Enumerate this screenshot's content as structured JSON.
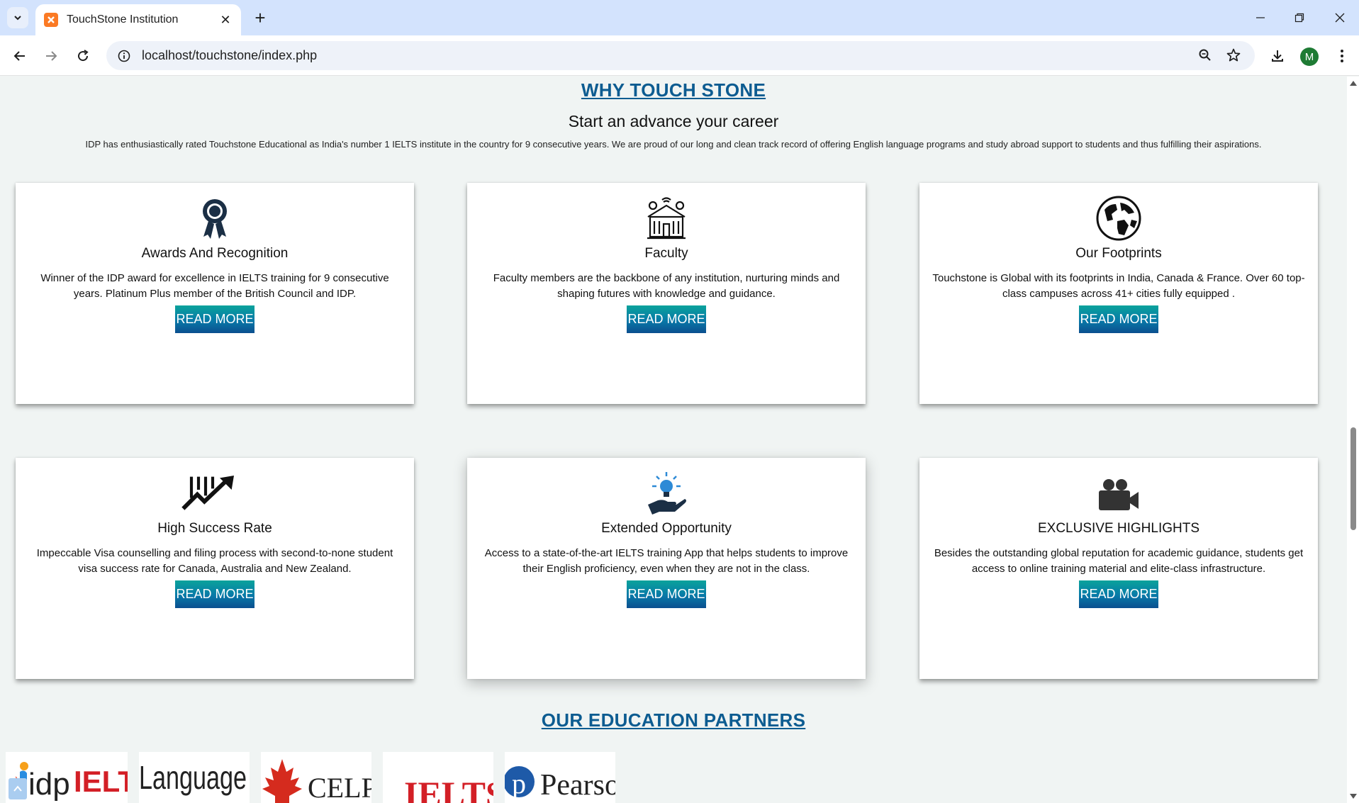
{
  "browser": {
    "tab_title": "TouchStone Institution",
    "url": "localhost/touchstone/index.php",
    "profile_initial": "M",
    "accent": "#d3e3fd"
  },
  "why": {
    "heading": "WHY TOUCH STONE",
    "subheading": "Start an advance your career",
    "intro": "IDP has enthusiastically rated Touchstone Educational as India's number 1 IELTS institute in the country for 9 consecutive years. We are proud of our long and clean track record of offering English language programs and study abroad support to students and thus fulfilling their aspirations."
  },
  "cards": [
    {
      "icon": "award-ribbon-icon",
      "title": "Awards And Recognition",
      "text": "Winner of the IDP award for excellence in IELTS training for 9 consecutive years. Platinum Plus member of the British Council and IDP.",
      "button": "READ MORE"
    },
    {
      "icon": "faculty-building-icon",
      "title": "Faculty",
      "text": "Faculty members are the backbone of any institution, nurturing minds and shaping futures with knowledge and guidance.",
      "button": "READ MORE"
    },
    {
      "icon": "globe-icon",
      "title": "Our Footprints",
      "text": "Touchstone is Global with its footprints in India, Canada & France. Over 60 top-class campuses across 41+ cities fully equipped .",
      "button": "READ MORE"
    },
    {
      "icon": "growth-arrow-icon",
      "title": "High Success Rate",
      "text": "Impeccable Visa counselling and filing process with second-to-none student visa success rate for Canada, Australia and New Zealand.",
      "button": "READ MORE"
    },
    {
      "icon": "idea-hand-icon",
      "title": "Extended Opportunity",
      "text": "Access to a state-of-the-art IELTS training App that helps students to improve their English proficiency, even when they are not in the class.",
      "button": "READ MORE"
    },
    {
      "icon": "video-camera-icon",
      "title": "EXCLUSIVE HIGHLIGHTS",
      "text": "Besides the outstanding global reputation for academic guidance, students get access to online training material and elite-class infrastructure.",
      "button": "READ MORE"
    }
  ],
  "partners": {
    "heading": "OUR EDUCATION PARTNERS",
    "logos": [
      {
        "name": "idp-ielts-logo",
        "text_a": "idp",
        "text_b": "IELTS"
      },
      {
        "name": "language-cert-logo",
        "text_a": "Language"
      },
      {
        "name": "celpip-logo",
        "text_a": "CELPIP"
      },
      {
        "name": "ielts-logo",
        "text_a": "IELTS"
      },
      {
        "name": "pearson-logo",
        "text_a": "Pearson"
      }
    ]
  }
}
